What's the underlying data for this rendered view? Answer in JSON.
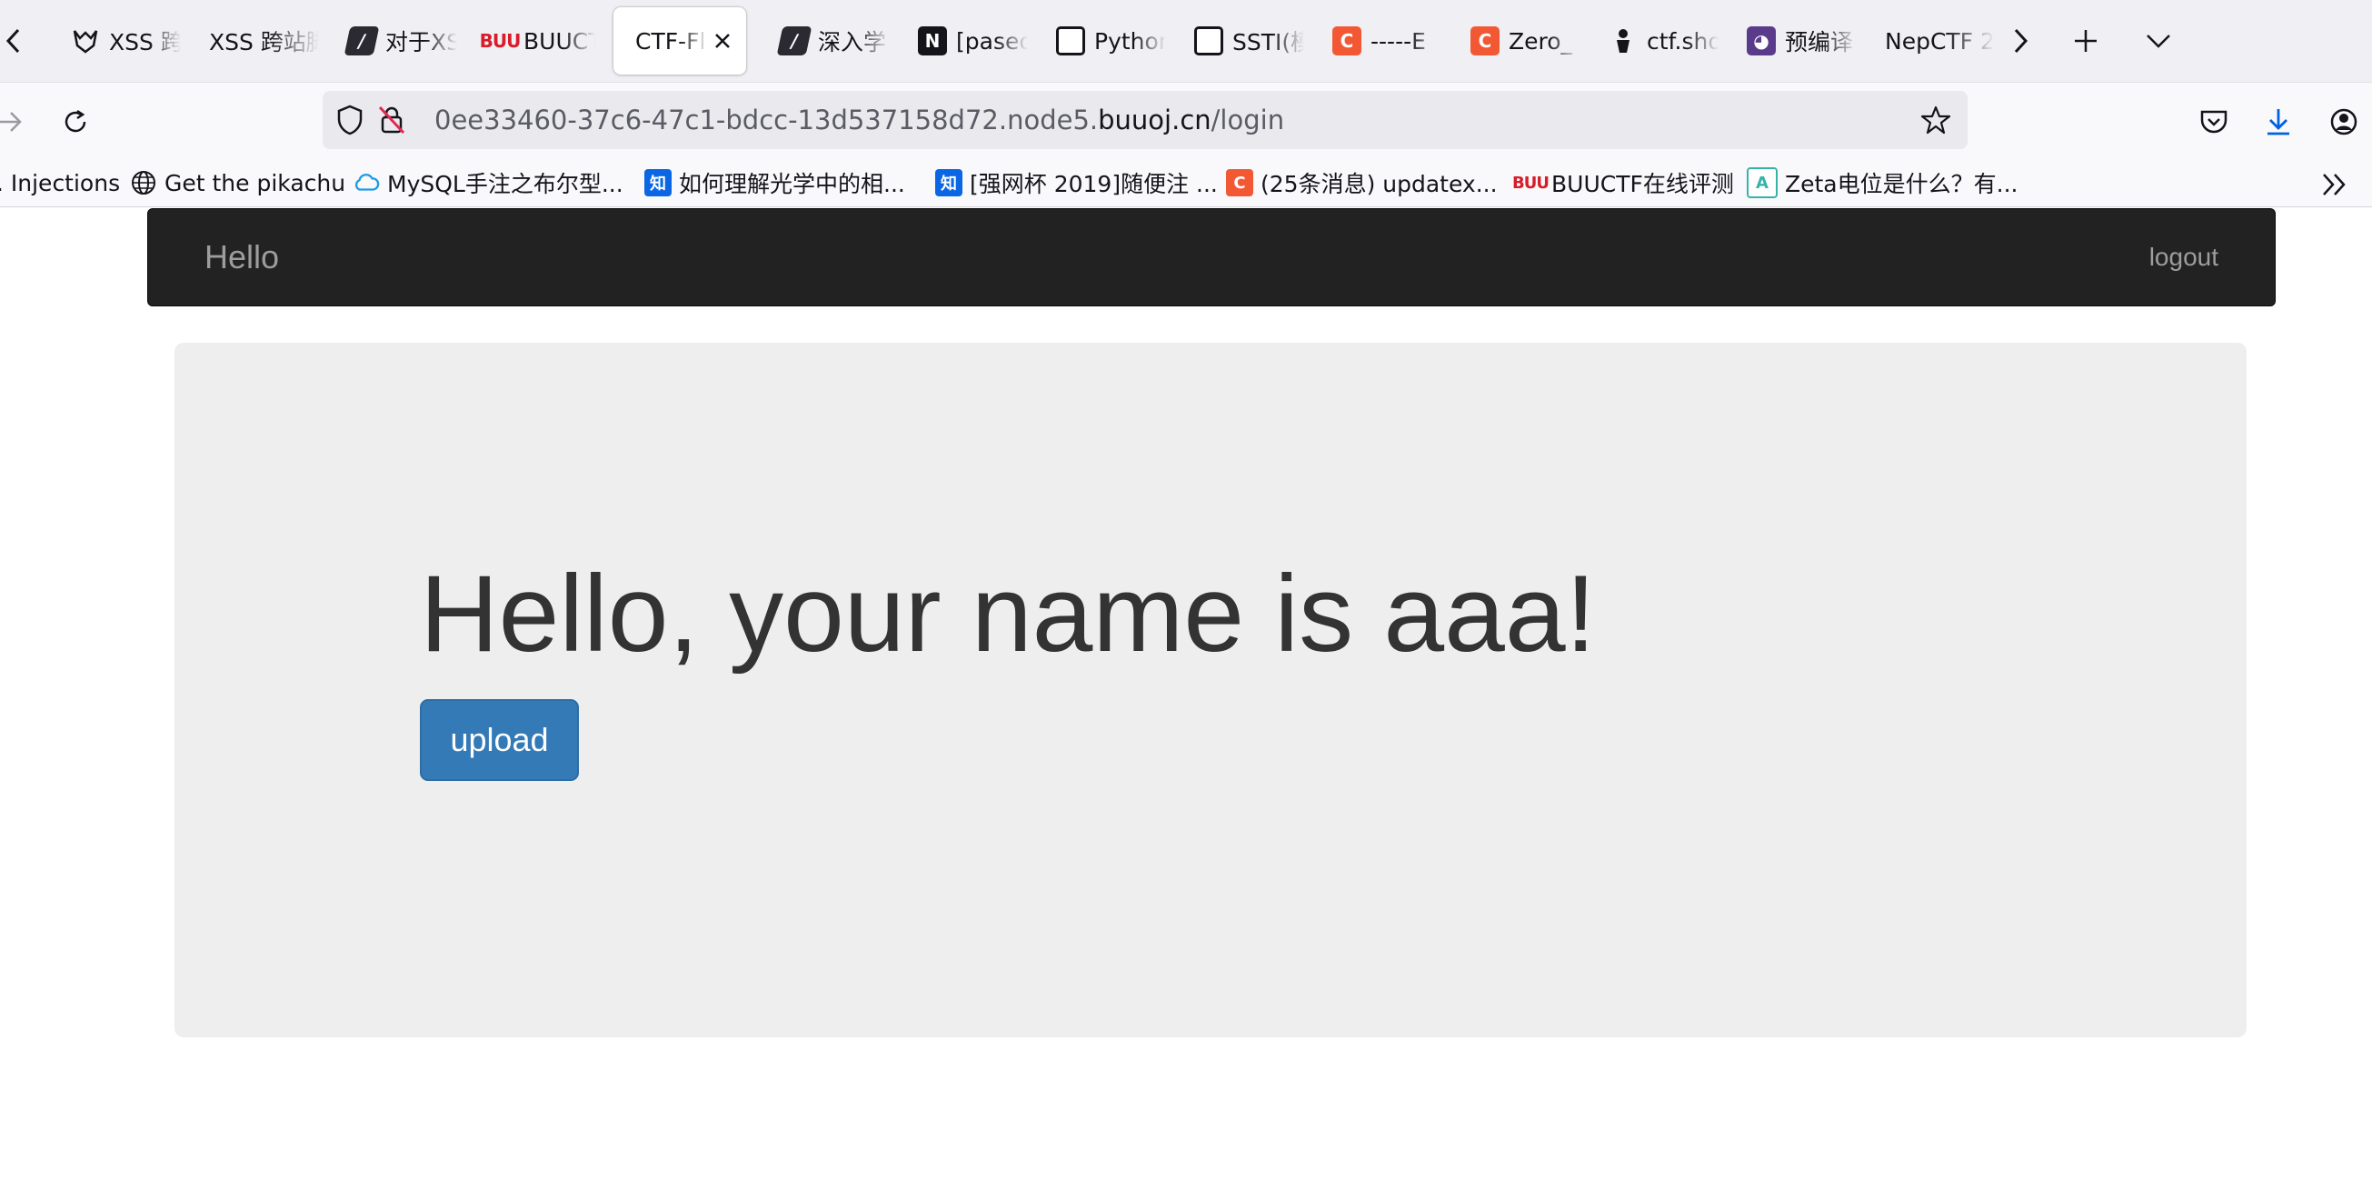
{
  "browser": {
    "tabs": [
      {
        "title": "XSS 跨",
        "icon": "wolf-icon",
        "active": false
      },
      {
        "title": "XSS 跨站脚",
        "icon": "none",
        "active": false
      },
      {
        "title": "对于XSS",
        "icon": "slash-icon",
        "active": false
      },
      {
        "title": "BUUCTF",
        "icon": "buuctf-icon",
        "active": false
      },
      {
        "title": "CTF-Flask",
        "icon": "none",
        "active": true
      },
      {
        "title": "深入学",
        "icon": "slash-icon",
        "active": false
      },
      {
        "title": "[paseo",
        "icon": "nodejs-icon",
        "active": false
      },
      {
        "title": "Python",
        "icon": "panda-icon",
        "active": false
      },
      {
        "title": "SSTI(模",
        "icon": "panda-icon",
        "active": false
      },
      {
        "title": "-----E",
        "icon": "csdn-icon",
        "active": false
      },
      {
        "title": "Zero_",
        "icon": "csdn-icon",
        "active": false
      },
      {
        "title": "ctf.sho",
        "icon": "ninja-icon",
        "active": false
      },
      {
        "title": "预编译",
        "icon": "anime-icon",
        "active": false
      },
      {
        "title": "NepCTF 2",
        "icon": "none",
        "active": false
      }
    ],
    "url": {
      "prefix": "0ee33460-37c6-47c1-bdcc-13d537158d72.node5.",
      "host": "buuoj.cn",
      "path": "/login"
    },
    "bookmarks": [
      {
        "label": ". Injections",
        "icon": "none"
      },
      {
        "label": "Get the pikachu",
        "icon": "globe-icon"
      },
      {
        "label": "MySQL手注之布尔型...",
        "icon": "cloud-icon"
      },
      {
        "label": "如何理解光学中的相...",
        "icon": "zhihu-icon"
      },
      {
        "label": "[强网杯 2019]随便注 ...",
        "icon": "zhihu-icon"
      },
      {
        "label": "(25条消息) updatex...",
        "icon": "csdn-icon"
      },
      {
        "label": "BUUCTF在线评测",
        "icon": "buuctf-icon"
      },
      {
        "label": "Zeta电位是什么？有...",
        "icon": "zeta-icon"
      }
    ]
  },
  "page": {
    "brand": "Hello",
    "logout": "logout",
    "heading": "Hello, your name is aaa!",
    "upload_label": "upload"
  },
  "colors": {
    "navbar_bg": "#222222",
    "navbar_text": "#9d9d9d",
    "jumbotron_bg": "#eeeeee",
    "primary_button": "#337ab7",
    "heading_text": "#333333"
  }
}
